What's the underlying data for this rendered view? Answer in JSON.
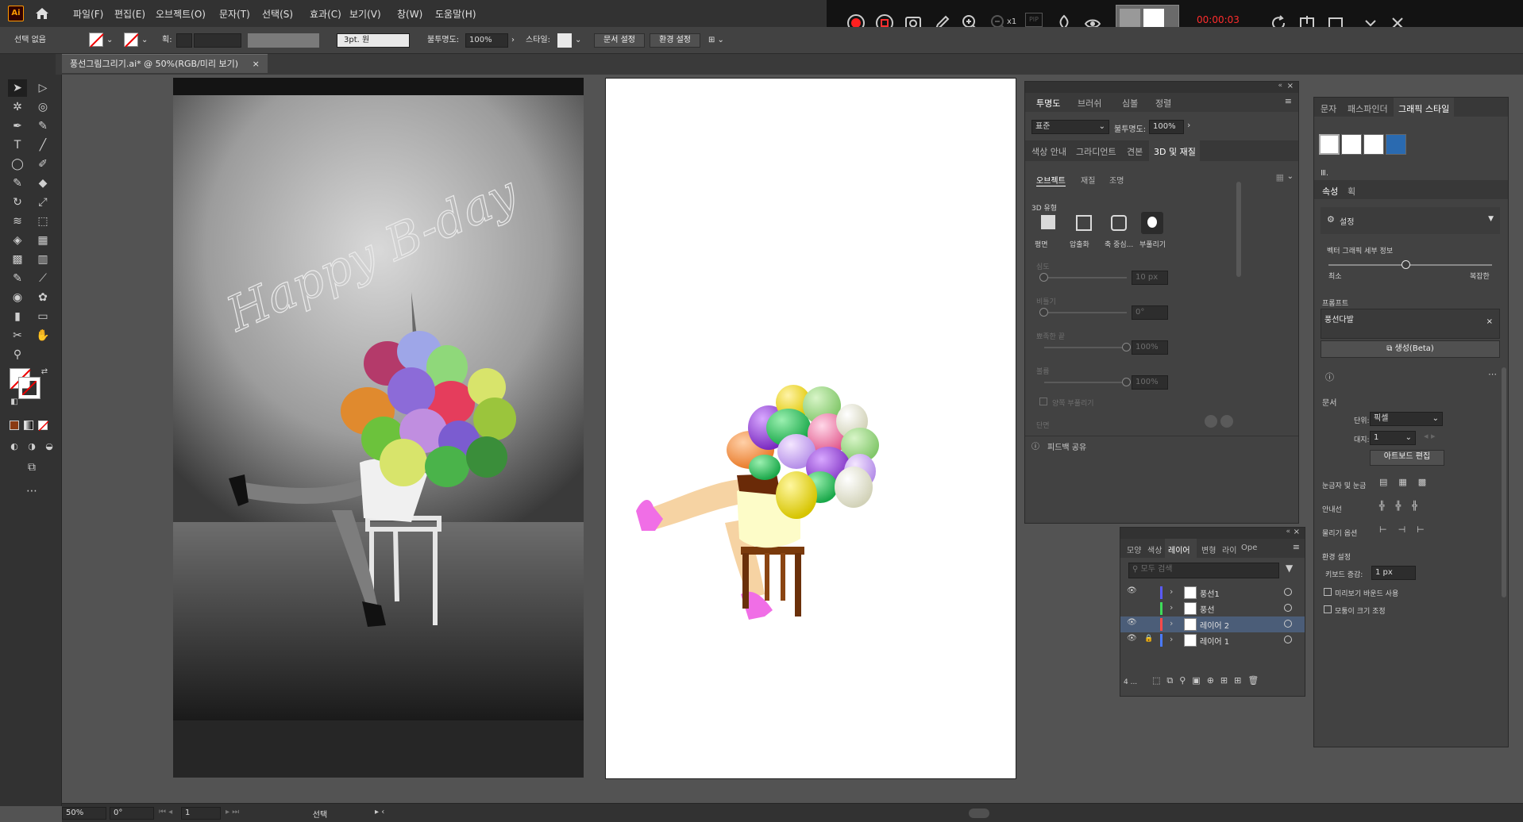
{
  "app": {
    "logo": "Ai",
    "menu": [
      "파일(F)",
      "편집(E)",
      "오브젝트(O)",
      "문자(T)",
      "선택(S)",
      "효과(C)",
      "보기(V)",
      "창(W)",
      "도움말(H)"
    ]
  },
  "control_bar": {
    "selection": "선택 없음",
    "stroke_label": "획:",
    "stroke_size": "3pt. 원",
    "opacity_label": "불투명도:",
    "opacity_value": "100%",
    "style_label": "스타일:",
    "doc_setup": "문서 설정",
    "preferences": "환경 설정"
  },
  "recorder": {
    "zoom_factor": "x1",
    "pip": "PIP",
    "timer": "00:00:03",
    "timer_color": "#ff2d2d"
  },
  "document": {
    "tab_title": "풍선그림그리기.ai* @ 50%(RGB/미리 보기)"
  },
  "photo": {
    "handwriting": "Happy B-day"
  },
  "transparency_panel": {
    "tabs": [
      "투명도",
      "브러쉬",
      "심볼",
      "정렬"
    ],
    "blend_mode": "표준",
    "opacity_label": "불투명도:",
    "opacity_value": "100%"
  },
  "three_d_panel": {
    "tabs": [
      "색상 안내",
      "그라디언트",
      "견본",
      "3D 및 재질"
    ],
    "subtabs": [
      "오브젝트",
      "재질",
      "조명"
    ],
    "type_label": "3D 유형",
    "types": [
      "평면",
      "압출화",
      "축 중심...",
      "부풀리기"
    ],
    "depth_label": "심도",
    "depth_value": "10 px",
    "twist_label": "비틀기",
    "twist_value": "0°",
    "taper_label": "뾰족한 끝",
    "taper_value": "100%",
    "volume_label": "볼륨",
    "volume_value": "100%",
    "both_sides": "양쪽 부풀리기",
    "cross_section": "단면",
    "feedback": "피드백 공유"
  },
  "layers_panel": {
    "tabs": [
      "모양",
      "색상",
      "레이어",
      "변형",
      "라이",
      "Ope"
    ],
    "search_placeholder": "모두 검색",
    "layers": [
      {
        "name": "풍선1",
        "color": "#5a5aff",
        "visible": true,
        "locked": false,
        "selected": false
      },
      {
        "name": "풍선",
        "color": "#3ddc5a",
        "visible": false,
        "locked": false,
        "selected": false
      },
      {
        "name": "레이어 2",
        "color": "#ff4a4a",
        "visible": true,
        "locked": false,
        "selected": true
      },
      {
        "name": "레이어 1",
        "color": "#4a7aff",
        "visible": true,
        "locked": true,
        "selected": false
      }
    ],
    "count": "4 ..."
  },
  "right_panel": {
    "tabs": [
      "문자",
      "패스파인더",
      "그래픽 스타일"
    ],
    "props_tabs": [
      "속성",
      "획"
    ],
    "settings_label": "설정",
    "vector_detail": "벡터 그래픽 세부 정보",
    "min_label": "최소",
    "max_label": "복잡한",
    "prompt_label": "프롬프트",
    "prompt_value": "풍선다발",
    "generate_label": "생성(Beta)",
    "document_section": "문서",
    "unit_label": "단위:",
    "unit_value": "픽셀",
    "artboard_label": "대지:",
    "artboard_value": "1",
    "edit_artboard": "아트보드 편집",
    "rulers_grid": "눈금자 및 눈금",
    "guides": "안내선",
    "snap_options": "물리기 옵션",
    "prefs_section": "환경 설정",
    "keyboard_increment_label": "키보드 증감:",
    "keyboard_increment_value": "1 px",
    "preview_bounds": "미리보기 바운드 사용",
    "scale_corners": "모퉁이 크기 조정"
  },
  "status_bar": {
    "zoom": "50%",
    "rotation": "0°",
    "artboard": "1",
    "tool": "선택"
  }
}
